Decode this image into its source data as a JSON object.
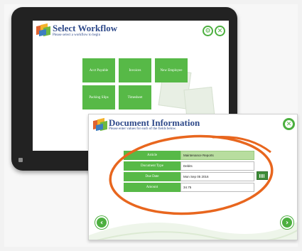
{
  "workflow_screen": {
    "title": "Select Workflow",
    "subtitle": "Please select a workflow to begin",
    "settings_icon": "gear-icon",
    "close_icon": "close-icon",
    "buttons": [
      {
        "label": "Acct Payable"
      },
      {
        "label": "Invoices"
      },
      {
        "label": "New Employee"
      },
      {
        "label": "Packing Slips"
      },
      {
        "label": "Timesheet"
      }
    ]
  },
  "document_dialog": {
    "title": "Document Information",
    "subtitle": "Please enter values for each of the fields below.",
    "fields": [
      {
        "label": "Article",
        "value": "Maintenance Reports"
      },
      {
        "label": "Document Type",
        "value": "Debits"
      },
      {
        "label": "Due Date",
        "value": "Mon Sep 05 2016"
      },
      {
        "label": "Amount",
        "value": "34.75"
      }
    ],
    "icons": {
      "close": "close-icon",
      "back": "arrow-left-icon",
      "next": "arrow-right-icon",
      "calendar": "calendar-icon"
    }
  },
  "colors": {
    "accent_green": "#57b947",
    "title_blue": "#2f4a8a",
    "highlight_orange": "#e8661e"
  }
}
